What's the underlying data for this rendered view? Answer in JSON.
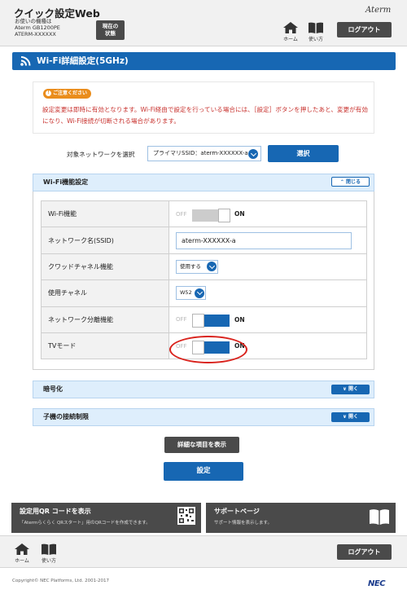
{
  "header": {
    "app_title": "クイック設定Web",
    "model_line1": "お使いの機種は",
    "model_line2": "Aterm GB1200PE",
    "model_line3": "ATERM-XXXXXX",
    "status_btn_line1": "現在の",
    "status_btn_line2": "状態",
    "brand": "Aterm",
    "home_label": "ホーム",
    "help_label": "使い方",
    "logout_label": "ログアウト"
  },
  "page": {
    "title": "Wi-Fi詳細設定(5GHz)"
  },
  "notice": {
    "badge": "ご注意ください",
    "text": "設定変更は即時に有効となります。Wi-Fi経由で設定を行っている場合には、［設定］ボタンを押したあと、変更が有効になり、Wi-Fi接続が切断される場合があります。"
  },
  "network_select": {
    "label": "対象ネットワークを選択",
    "value": "プライマリSSID：aterm-XXXXXX-a",
    "button": "選択"
  },
  "wifi_section": {
    "title": "Wi-Fi機能設定",
    "collapse_label": "閉じる",
    "rows": [
      {
        "label": "Wi-Fi機能",
        "off": "OFF",
        "on": "ON"
      },
      {
        "label": "ネットワーク名(SSID)",
        "value": "aterm-XXXXXX-a"
      },
      {
        "label": "クワッドチャネル機能",
        "value": "使用する"
      },
      {
        "label": "使用チャネル",
        "value": "W52"
      },
      {
        "label": "ネットワーク分離機能",
        "off": "OFF",
        "on": "ON"
      },
      {
        "label": "TVモード",
        "off": "OFF",
        "on": "ON"
      }
    ]
  },
  "encryption_section": {
    "title": "暗号化",
    "expand_label": "開く"
  },
  "client_limit_section": {
    "title": "子機の接続制限",
    "expand_label": "開く"
  },
  "buttons": {
    "show_details": "詳細な項目を表示",
    "apply": "設定"
  },
  "panels": {
    "qr_title": "設定用QR コードを表示",
    "qr_desc": "「Atermらくらく QRスタート」用のQRコードを作成できます。",
    "support_title": "サポートページ",
    "support_desc": "サポート情報を表示します。"
  },
  "footer": {
    "home_label": "ホーム",
    "help_label": "使い方",
    "logout_label": "ログアウト",
    "copyright": "Copyright© NEC Platforms, Ltd. 2001-2017",
    "vendor_logo": "NEC"
  },
  "colors": {
    "primary_blue": "#1767b3",
    "dark_button": "#4a4a4a",
    "notice_orange": "#ea8d1c",
    "notice_red": "#c8322e",
    "highlight_red": "#d9221c"
  }
}
